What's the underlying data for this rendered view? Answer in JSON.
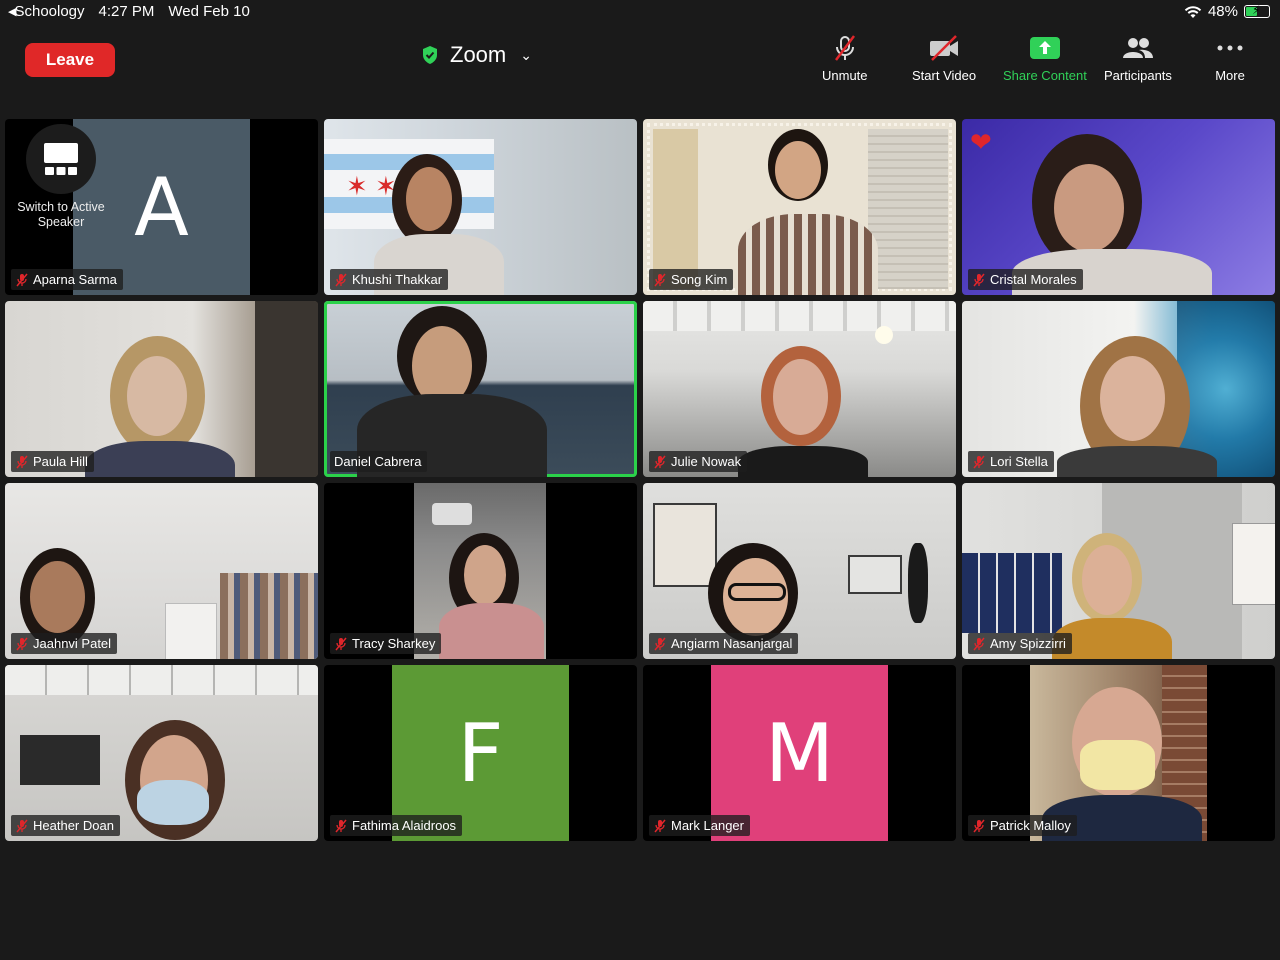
{
  "status_bar": {
    "back_app": "Schoology",
    "time": "4:27 PM",
    "date": "Wed Feb 10",
    "battery_percent": "48%"
  },
  "toolbar": {
    "leave_label": "Leave",
    "meeting_title": "Zoom",
    "unmute_label": "Unmute",
    "start_video_label": "Start Video",
    "share_content_label": "Share Content",
    "participants_label": "Participants",
    "more_label": "More"
  },
  "switch_speaker_label": "Switch to Active Speaker",
  "participants": [
    {
      "name": "Aparna Sarma",
      "initial": "A"
    },
    {
      "name": "Khushi Thakkar"
    },
    {
      "name": "Song Kim"
    },
    {
      "name": "Cristal Morales"
    },
    {
      "name": "Paula Hill"
    },
    {
      "name": "Daniel Cabrera"
    },
    {
      "name": "Julie Nowak"
    },
    {
      "name": "Lori Stella"
    },
    {
      "name": "Jaahnvi Patel"
    },
    {
      "name": "Tracy Sharkey"
    },
    {
      "name": "Angiarm Nasanjargal"
    },
    {
      "name": "Amy Spizzirri"
    },
    {
      "name": "Heather Doan"
    },
    {
      "name": "Fathima Alaidroos",
      "initial": "F"
    },
    {
      "name": "Mark Langer",
      "initial": "M"
    },
    {
      "name": "Patrick Malloy"
    }
  ],
  "colors": {
    "leave": "#e02828",
    "share_green": "#30d158",
    "active_border": "#2bd14a",
    "avatar_a": "#4a5a66",
    "avatar_f": "#5c9a35",
    "avatar_m": "#e0407a",
    "muted_red": "#e0262b"
  }
}
